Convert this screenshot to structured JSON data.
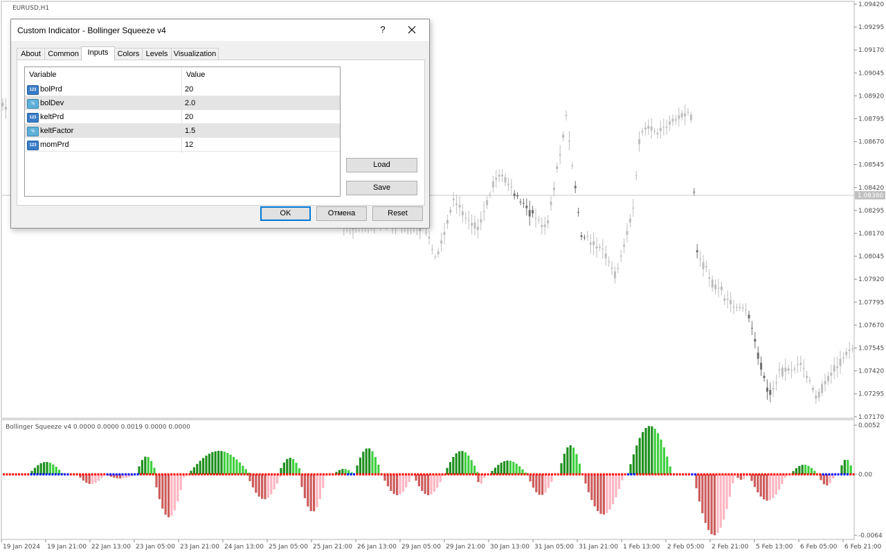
{
  "chart": {
    "symbol_label": "EURUSD,H1",
    "indicator_label": "Bollinger Squeeze v4 0.0000 0.0000 0.0019 0.0000 0.0000",
    "current_price_label": "1.08380",
    "price_axis": [
      "1.09420",
      "1.09295",
      "1.09170",
      "1.09045",
      "1.08920",
      "1.08795",
      "1.08670",
      "1.08545",
      "1.08420",
      "1.08295",
      "1.08170",
      "1.08045",
      "1.07920",
      "1.07795",
      "1.07670",
      "1.07545",
      "1.07420",
      "1.07295",
      "1.07170"
    ],
    "indicator_axis": [
      "0.0052",
      "0.00",
      "-0.0064"
    ],
    "time_axis": [
      "19 Jan 2024",
      "19 Jan 21:00",
      "22 Jan 13:00",
      "23 Jan 05:00",
      "23 Jan 21:00",
      "24 Jan 13:00",
      "25 Jan 05:00",
      "25 Jan 21:00",
      "26 Jan 13:00",
      "29 Jan 05:00",
      "29 Jan 21:00",
      "30 Jan 13:00",
      "31 Jan 05:00",
      "31 Jan 21:00",
      "1 Feb 13:00",
      "2 Feb 05:00",
      "2 Feb 21:00",
      "5 Feb 13:00",
      "6 Feb 05:00",
      "6 Feb 21:00"
    ],
    "colors": {
      "candle": "#bdbdbd",
      "candle_dark": "#6e6e6e",
      "hist_up": "#1f8f1f",
      "hist_up_light": "#3fcf3f",
      "hist_down": "#cd5c5c",
      "hist_down_light": "#ffb6c1",
      "dot_red": "#ff0000",
      "dot_blue": "#0000ff"
    }
  },
  "dialog": {
    "title": "Custom Indicator - Bollinger Squeeze v4",
    "help_label": "?",
    "tabs": [
      "About",
      "Common",
      "Inputs",
      "Colors",
      "Levels",
      "Visualization"
    ],
    "active_tab": "Inputs",
    "table": {
      "headers": [
        "Variable",
        "Value"
      ],
      "rows": [
        {
          "icon": "integer-type-icon",
          "icon_text": "123",
          "variable": "bolPrd",
          "value": "20"
        },
        {
          "icon": "double-type-icon",
          "icon_text": "½",
          "variable": "bolDev",
          "value": "2.0"
        },
        {
          "icon": "integer-type-icon",
          "icon_text": "123",
          "variable": "keltPrd",
          "value": "20"
        },
        {
          "icon": "double-type-icon",
          "icon_text": "½",
          "variable": "keltFactor",
          "value": "1.5"
        },
        {
          "icon": "integer-type-icon",
          "icon_text": "123",
          "variable": "momPrd",
          "value": "12"
        }
      ]
    },
    "load_label": "Load",
    "save_label": "Save",
    "ok_label": "OK",
    "cancel_label": "Отмена",
    "reset_label": "Reset"
  }
}
